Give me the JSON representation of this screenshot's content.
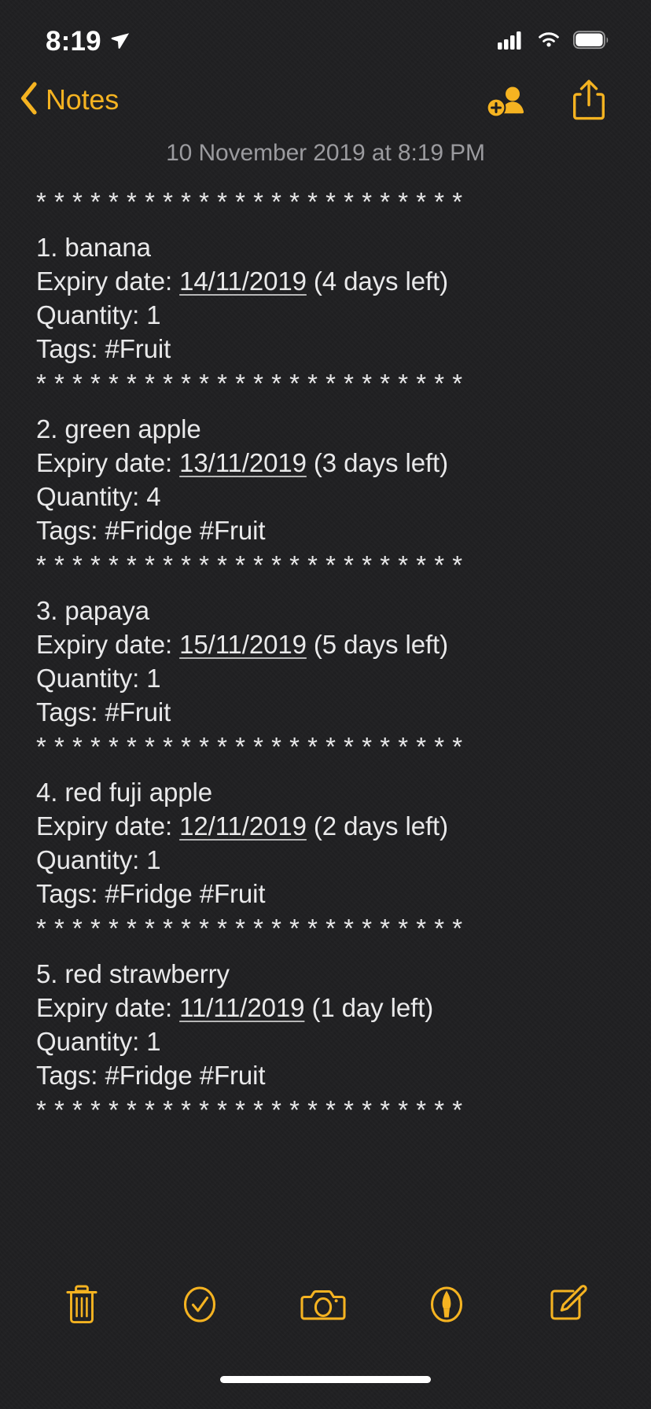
{
  "status_bar": {
    "time": "8:19",
    "location_icon": "location-arrow-icon",
    "cellular_icon": "cellular-signal-icon",
    "wifi_icon": "wifi-icon",
    "battery_icon": "battery-full-icon"
  },
  "nav": {
    "back_label": "Notes",
    "back_icon": "chevron-left-icon",
    "add_people_icon": "add-person-icon",
    "share_icon": "share-icon"
  },
  "note": {
    "date": "10 November 2019 at 8:19 PM",
    "separator": "* * * * * * * * * * * * * * * * * * * * * * * *",
    "items": [
      {
        "title": "1. banana",
        "expiry_label": "Expiry date: ",
        "expiry_date": "14/11/2019",
        "days_left": " (4 days left)",
        "quantity": "Quantity: 1",
        "tags": "Tags: #Fruit"
      },
      {
        "title": "2. green apple",
        "expiry_label": "Expiry date: ",
        "expiry_date": "13/11/2019",
        "days_left": " (3 days left)",
        "quantity": "Quantity: 4",
        "tags": "Tags: #Fridge #Fruit"
      },
      {
        "title": "3. papaya",
        "expiry_label": "Expiry date: ",
        "expiry_date": "15/11/2019",
        "days_left": " (5 days left)",
        "quantity": "Quantity: 1",
        "tags": "Tags: #Fruit"
      },
      {
        "title": "4. red fuji apple",
        "expiry_label": "Expiry date: ",
        "expiry_date": "12/11/2019",
        "days_left": " (2 days left)",
        "quantity": "Quantity: 1",
        "tags": "Tags: #Fridge #Fruit"
      },
      {
        "title": "5. red strawberry",
        "expiry_label": "Expiry date: ",
        "expiry_date": "11/11/2019",
        "days_left": " (1 day left)",
        "quantity": "Quantity: 1",
        "tags": "Tags: #Fridge #Fruit"
      }
    ]
  },
  "toolbar": {
    "items": [
      {
        "icon": "trash-icon",
        "name": "delete-button"
      },
      {
        "icon": "checkmark-circle-icon",
        "name": "checklist-button"
      },
      {
        "icon": "camera-icon",
        "name": "camera-button"
      },
      {
        "icon": "markup-pen-circle-icon",
        "name": "markup-button"
      },
      {
        "icon": "compose-icon",
        "name": "compose-button"
      }
    ]
  },
  "colors": {
    "accent": "#f5b321",
    "background": "#1f1f21",
    "text": "#e9e9ea",
    "muted": "#9b9b9f"
  }
}
